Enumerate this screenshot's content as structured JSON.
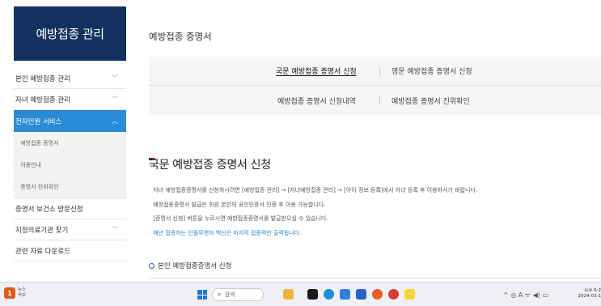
{
  "sidebar": {
    "title": "예방접종 관리",
    "items": [
      {
        "label": "본인 예방접종 관리",
        "chevron": "﹀"
      },
      {
        "label": "자녀 예방접종 관리",
        "chevron": "﹀"
      }
    ],
    "active_item": {
      "label": "전자민원 서비스",
      "chevron": "︿"
    },
    "sub_items": [
      {
        "label": "예방접종 증명서"
      },
      {
        "label": "이용안내"
      },
      {
        "label": "증명서 진위확인"
      }
    ],
    "more_items": [
      {
        "label": "증명서 보건소 방문신청",
        "chevron": ""
      },
      {
        "label": "지정의료기관 찾기",
        "chevron": "﹀"
      },
      {
        "label": "관련 자료 다운로드",
        "chevron": ""
      }
    ]
  },
  "main": {
    "page_title": "예방접종 증명서",
    "tabs": {
      "row1": [
        "국문 예방접종 증명서 신청",
        "영문 예방접종 증명서 신청"
      ],
      "row2": [
        "예방접종 증명서 신청내역",
        "예방접종 증명서 진위확인"
      ]
    },
    "section_title": "국문 예방접종 증명서 신청",
    "info_lines": [
      "자녀 예방접종증명서를 신청하시려면 [예방접종 관리] → [자녀예방접종 관리] → [아이 정보 등록]에서 자녀 등록 후 이용하시기 바랍니다.",
      "예방접종증명서 발급은 회원 본인의 공인인증서 인증 후 이용 가능합니다.",
      "[증명서 신청] 버튼을 누르시면 예방접종증명서를 발급받으실 수 있습니다.",
      "매년 접종하는 인플루엔자 백신은 마지막 접종력만 출력됩니다."
    ],
    "sub_heading": "본인 예방접종증명서 신청"
  },
  "taskbar": {
    "news_badge": "1",
    "news_title": "뉴스",
    "news_sub": "속보",
    "search_placeholder": "검색",
    "search_icon": "magnifier-icon",
    "tray": "^  ◎  A  ᯤ  ◀)  ▭",
    "clock_time": "오후 6:2",
    "clock_date": "2024-03-1"
  },
  "colors": {
    "sidebar_header": "#12315f",
    "active_blue": "#2a8ad6",
    "tab_bg": "#f4f6f8"
  }
}
